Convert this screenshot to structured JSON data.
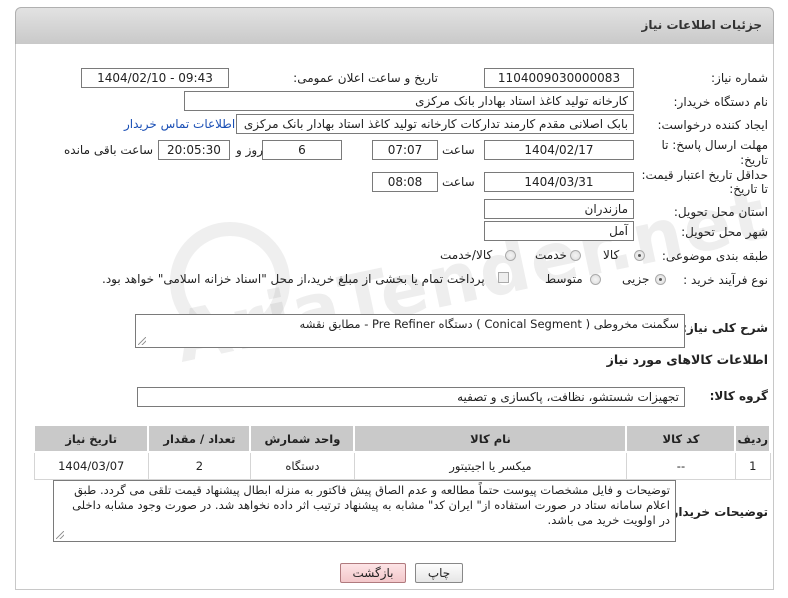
{
  "header": {
    "title": "جزئیات اطلاعات نیاز"
  },
  "fields": {
    "need_number_label": "شماره نیاز:",
    "need_number": "1104009030000083",
    "announce_label": "تاریخ و ساعت اعلان عمومی:",
    "announce_value": "1404/02/10 - 09:43",
    "buyer_org_label": "نام دستگاه خریدار:",
    "buyer_org": "کارخانه تولید کاغذ استاد بهادار بانک مرکزی",
    "requester_label": "ایجاد کننده درخواست:",
    "requester": "بابک اصلانی مقدم کارمند تدارکات کارخانه تولید کاغذ استاد بهادار بانک مرکزی",
    "contact_link": "اطلاعات تماس خریدار",
    "reply_deadline_label_1": "مهلت ارسال پاسخ: تا",
    "reply_deadline_label_2": "تاریخ:",
    "reply_date": "1404/02/17",
    "time_label": "ساعت",
    "reply_time": "07:07",
    "days_value": "6",
    "days_label": "روز و",
    "remaining_time": "20:05:30",
    "remaining_label": "ساعت باقی مانده",
    "price_validity_label_1": "حداقل تاریخ اعتبار قیمت:",
    "price_validity_label_2": "تا تاریخ:",
    "validity_date": "1404/03/31",
    "validity_time_label": "ساعت",
    "validity_time": "08:08",
    "province_label": "استان محل تحویل:",
    "province": "مازندران",
    "city_label": "شهر محل تحویل:",
    "city": "آمل",
    "category_label": "طبقه بندی موضوعی:",
    "category_options": [
      "کالا",
      "خدمت",
      "کالا/خدمت"
    ],
    "process_label": "نوع فرآیند خرید :",
    "process_options": [
      "جزیی",
      "متوسط"
    ],
    "payment_note": "پرداخت تمام یا بخشی از مبلغ خرید،از محل \"اسناد خزانه اسلامی\" خواهد بود."
  },
  "description": {
    "label": "شرح کلی نیاز:",
    "text": "سگمنت مخروطی ( Conical Segment ) دستگاه Pre Refiner - مطابق نقشه"
  },
  "goods": {
    "section_title": "اطلاعات کالاهای مورد نیاز",
    "group_label": "گروه کالا:",
    "group_value": "تجهیزات شستشو، نظافت، پاکسازی و تصفیه",
    "columns": [
      "ردیف",
      "کد کالا",
      "نام کالا",
      "واحد شمارش",
      "تعداد / مقدار",
      "تاریخ نیاز"
    ],
    "rows": [
      {
        "index": "1",
        "code": "--",
        "name": "میکسر یا اجیتیتور",
        "unit": "دستگاه",
        "qty": "2",
        "date": "1404/03/07"
      }
    ]
  },
  "buyer_notes": {
    "label": "توضیحات خریدار:",
    "text": "توضیحات و فایل مشخصات پیوست حتماً مطالعه و عدم الصاق پیش فاکتور به منزله ابطال پیشنهاد قیمت تلقی می گردد. طبق اعلام سامانه ستاد در صورت استفاده از\" ایران کد\" مشابه به پیشنهاد ترتیب اثر داده نخواهد شد. در صورت وجود مشابه داخلی در اولویت خرید می باشد."
  },
  "buttons": {
    "print": "چاپ",
    "back": "بازگشت"
  }
}
